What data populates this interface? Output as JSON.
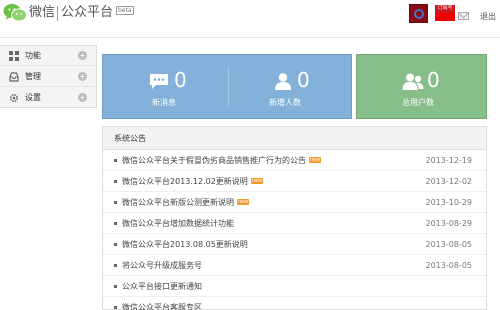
{
  "header": {
    "brand": "微信",
    "platform": "公众平台",
    "beta_tag": "beta",
    "flag_text": "订阅号",
    "logout": "退出"
  },
  "sidebar": {
    "items": [
      {
        "label": "功能",
        "icon": "grid-icon"
      },
      {
        "label": "管理",
        "icon": "inbox-icon"
      },
      {
        "label": "设置",
        "icon": "gear-icon"
      }
    ],
    "expand_symbol": "+"
  },
  "stats": [
    {
      "value": "0",
      "label": "新消息",
      "icon": "chat-bubble-icon"
    },
    {
      "value": "0",
      "label": "新增人数",
      "icon": "person-icon"
    },
    {
      "value": "0",
      "label": "总用户数",
      "icon": "people-icon"
    }
  ],
  "notices": {
    "title": "系统公告",
    "new_badge": "new",
    "items": [
      {
        "title": "微信公众平台关于假冒伪劣商品销售推广行为的公告",
        "date": "2013-12-19",
        "is_new": true
      },
      {
        "title": "微信公众平台2013.12.02更新说明",
        "date": "2013-12-02",
        "is_new": true
      },
      {
        "title": "微信公众平台新版公测更新说明",
        "date": "2013-10-29",
        "is_new": true
      },
      {
        "title": "微信公众平台增加数据统计功能",
        "date": "2013-08-29",
        "is_new": false
      },
      {
        "title": "微信公众平台2013.08.05更新说明",
        "date": "2013-08-05",
        "is_new": false
      },
      {
        "title": "将公众号升级成服务号",
        "date": "2013-08-05",
        "is_new": false
      },
      {
        "title": "公众平台接口更新通知",
        "date": "",
        "is_new": false
      },
      {
        "title": "微信公众平台客服专区",
        "date": "",
        "is_new": false
      }
    ]
  },
  "colors": {
    "blue_panel": "#84b1da",
    "green_panel": "#87be8a",
    "new_badge": "#f09a2a",
    "wechat_green": "#5cb85c"
  }
}
